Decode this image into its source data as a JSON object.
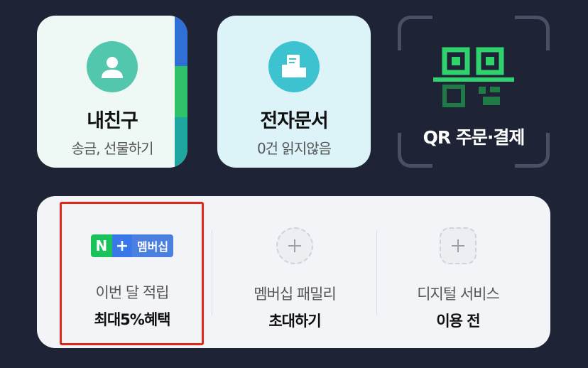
{
  "friends_card": {
    "title": "내친구",
    "subtitle": "송금, 선물하기"
  },
  "docs_card": {
    "title": "전자문서",
    "subtitle": "0건 읽지않음"
  },
  "qr_card": {
    "label": "QR 주문·결제"
  },
  "membership": {
    "badge": {
      "n": "N",
      "plus": "+",
      "text": "멤버십"
    },
    "earn": {
      "line1": "이번 달 적립",
      "line2": "최대5%혜택"
    },
    "family": {
      "line1": "멤버십 패밀리",
      "line2": "초대하기"
    },
    "digital": {
      "line1": "디지털 서비스",
      "line2": "이용 전"
    }
  },
  "colors": {
    "background": "#1f2336",
    "friends_card": "#eef9f6",
    "docs_card": "#dcf3f8",
    "avatar": "#4ec9b0",
    "qr_green": "#2fd36e",
    "highlight": "#e0291b"
  }
}
